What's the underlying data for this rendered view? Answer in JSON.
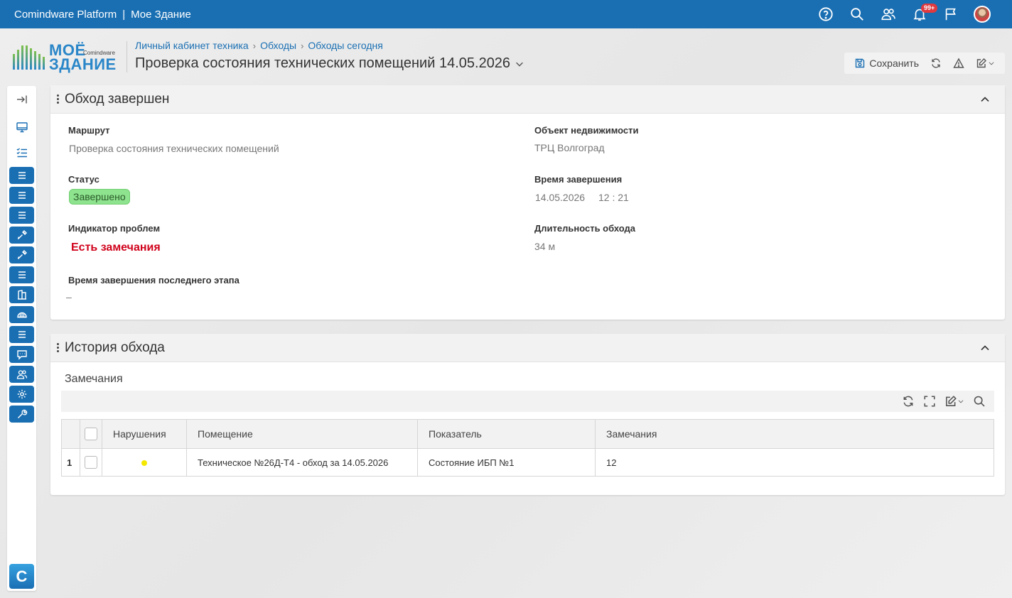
{
  "app": {
    "platform": "Comindware Platform",
    "separator": "|",
    "app_name": "Мое Здание",
    "notifications_badge": "99+"
  },
  "logo": {
    "word1": "МОЁ",
    "word2": "ЗДАНИЕ",
    "brand": "Comindware"
  },
  "breadcrumb": [
    "Личный кабинет техника",
    "Обходы",
    "Обходы сегодня"
  ],
  "page_title": "Проверка состояния технических помещений 14.05.2026",
  "toolbar": {
    "save_label": "Сохранить"
  },
  "summary_panel": {
    "title": "Обход завершен",
    "route_label": "Маршрут",
    "route_value": "Проверка состояния технических помещений",
    "object_label": "Объект недвижимости",
    "object_value": "ТРЦ Волгоград",
    "status_label": "Статус",
    "status_value": "Завершено",
    "completion_time_label": "Время завершения",
    "completion_date": "14.05.2026",
    "completion_time": "12 : 21",
    "problem_label": "Индикатор проблем",
    "problem_value": "Есть замечания",
    "duration_label": "Длительность обхода",
    "duration_value": "34 м",
    "last_stage_label": "Время завершения последнего этапа",
    "last_stage_value": "–"
  },
  "history_panel": {
    "title": "История обхода",
    "grid_title": "Замечания",
    "columns": [
      "Нарушения",
      "Помещение",
      "Показатель",
      "Замечания"
    ],
    "rows": [
      {
        "num": "1",
        "violation_color": "#f5e800",
        "room": "Техническое №26Д-Т4 - обход за 14.05.2026",
        "indicator": "Состояние ИБП №1",
        "remarks": "12"
      }
    ]
  },
  "nav_logo": "C",
  "colors": {
    "primary": "#1a6fb3",
    "status_done": "#8ee38e",
    "problem": "#d0021b"
  }
}
